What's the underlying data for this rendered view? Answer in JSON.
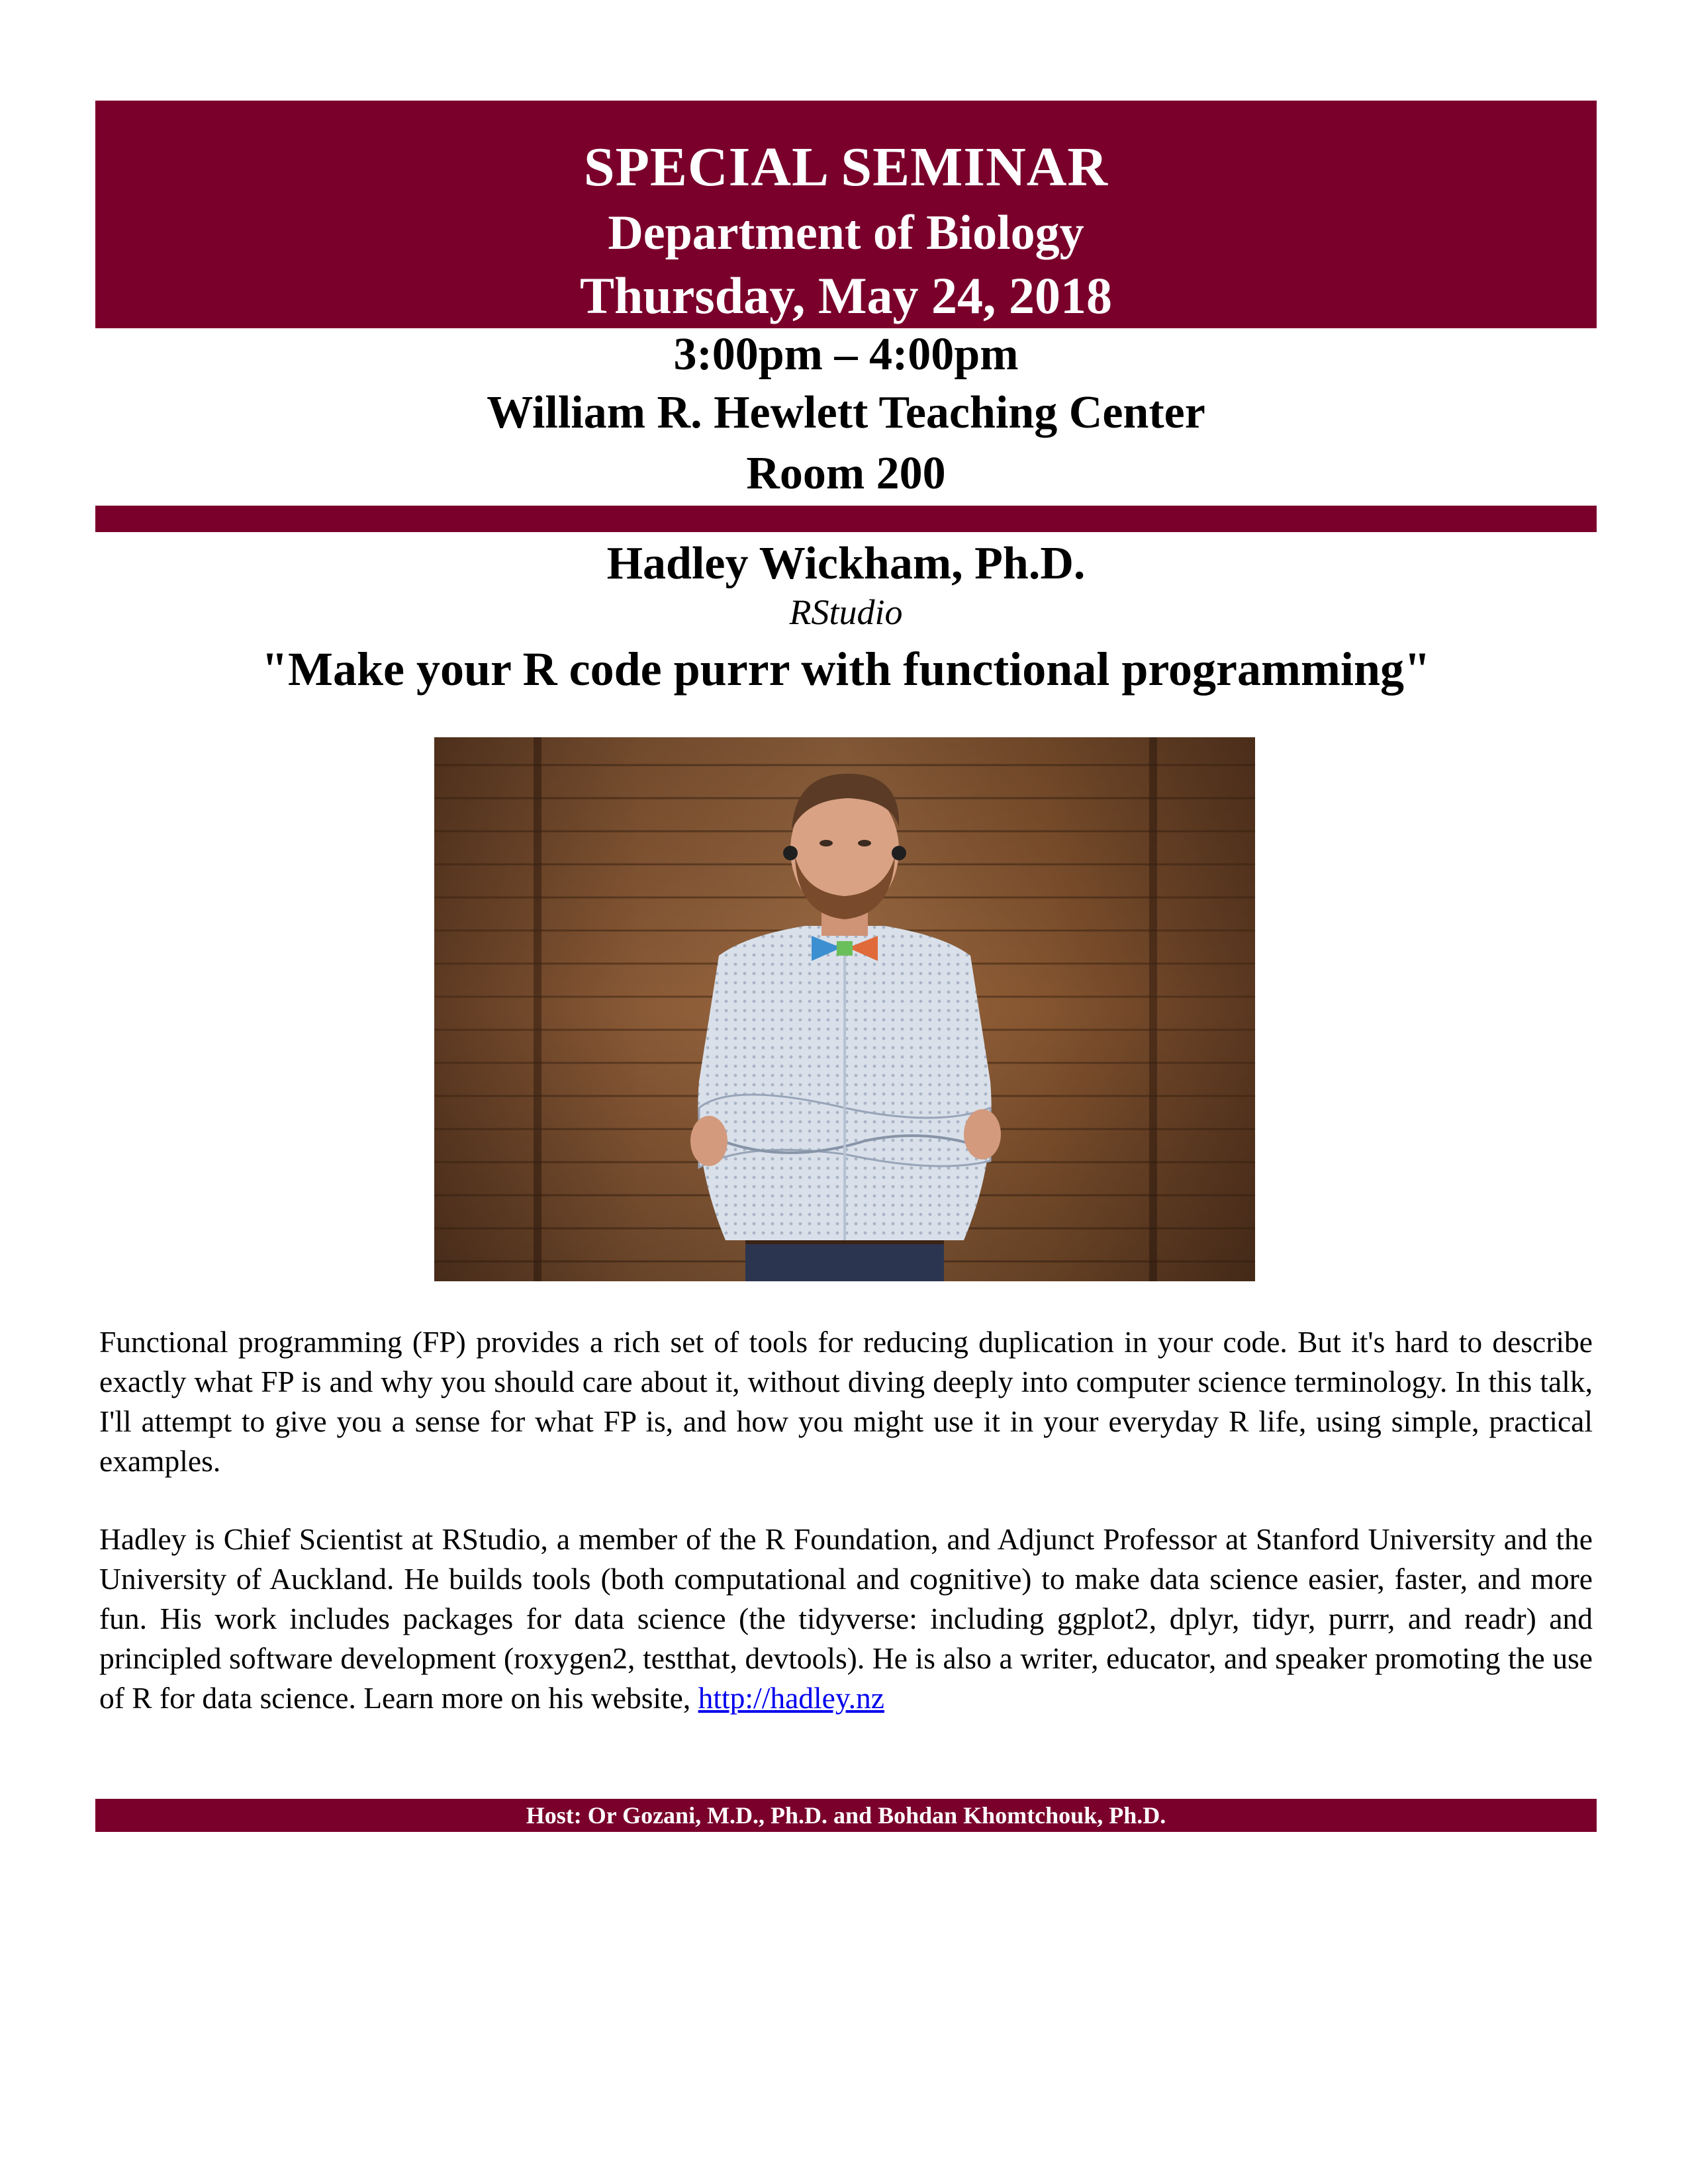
{
  "header": {
    "title": "SPECIAL SEMINAR",
    "department": "Department of Biology",
    "date": "Thursday, May 24, 2018"
  },
  "event": {
    "time": "3:00pm – 4:00pm",
    "venue": "William R. Hewlett Teaching Center",
    "room": "Room 200"
  },
  "speaker": {
    "name": "Hadley Wickham, Ph.D.",
    "affiliation": "RStudio",
    "talk_title": "\"Make your R code purrr with functional programming\""
  },
  "abstract": "Functional programming (FP) provides a rich set of tools for reducing duplication in your code. But it's hard to describe exactly what FP is and why you should care about it, without diving deeply into computer science terminology. In this talk, I'll attempt to give you a sense for what FP is, and how you might use it in your everyday R life, using simple, practical examples.",
  "bio": {
    "text": "Hadley is Chief Scientist at RStudio, a member of the R Foundation, and Adjunct Professor at Stanford University and the University of Auckland. He builds tools (both computational and cognitive) to make data science easier, faster, and more fun. His work includes packages for data science (the tidyverse: including ggplot2, dplyr, tidyr, purrr, and readr) and principled software development (roxygen2, testthat, devtools). He is also a writer, educator, and speaker promoting the use of R for data science. Learn more on his website,",
    "link_text": "http://hadley.nz",
    "link_href": "http://hadley.nz"
  },
  "host": "Host: Or Gozani, M.D., Ph.D. and Bohdan Khomtchouk, Ph.D.",
  "colors": {
    "brand_maroon": "#7a002b",
    "link_blue": "#0000ee"
  }
}
